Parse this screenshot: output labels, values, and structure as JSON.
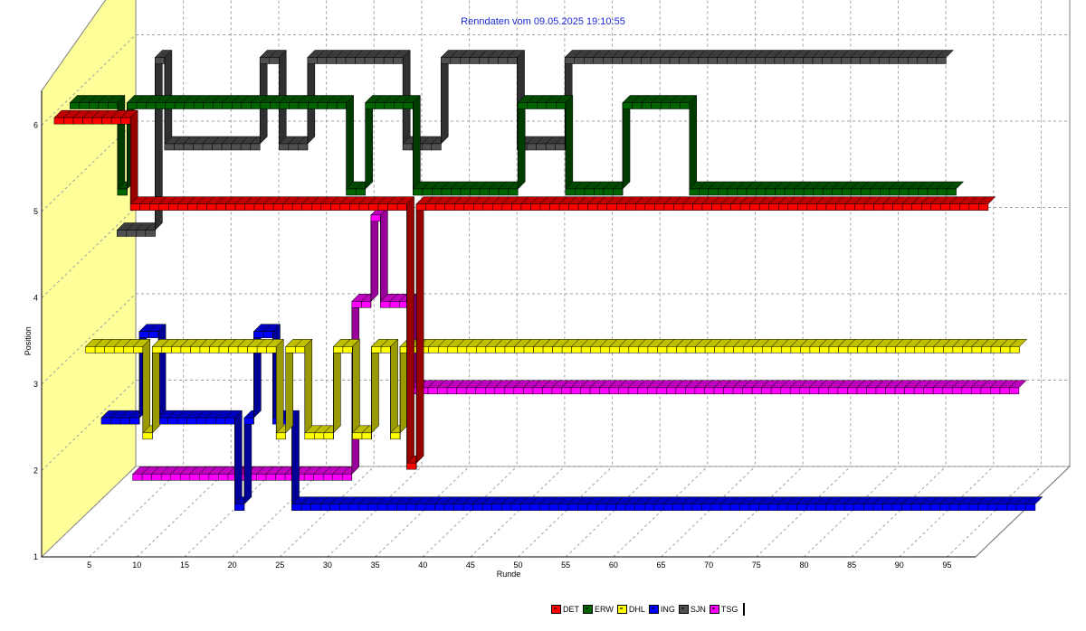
{
  "chart_data": {
    "type": "line",
    "title": "Renndaten vom 09.05.2025 19:10:55",
    "xlabel": "Runde",
    "ylabel": "Position",
    "xlim": [
      0,
      98
    ],
    "ylim": [
      1,
      6
    ],
    "x_ticks": [
      "5",
      "10",
      "15",
      "20",
      "25",
      "30",
      "35",
      "40",
      "45",
      "50",
      "55",
      "60",
      "65",
      "70",
      "75",
      "80",
      "85",
      "90",
      "95"
    ],
    "y_ticks": [
      "1",
      "2",
      "3",
      "4",
      "5",
      "6"
    ],
    "grid": true,
    "legend_position": "bottom",
    "series": [
      {
        "name": "DET",
        "color": "#ff0000",
        "x_start": 1,
        "x_end": 98,
        "segments": [
          [
            1,
            4,
            6
          ],
          [
            5,
            8,
            6
          ],
          [
            9,
            37,
            5
          ],
          [
            38,
            38,
            2
          ],
          [
            39,
            98,
            5
          ]
        ]
      },
      {
        "name": "ERW",
        "color": "#006400",
        "x_start": 1,
        "x_end": 93,
        "segments": [
          [
            1,
            5,
            6
          ],
          [
            6,
            6,
            5
          ],
          [
            7,
            29,
            6
          ],
          [
            30,
            31,
            5
          ],
          [
            32,
            36,
            6
          ],
          [
            37,
            47,
            5
          ],
          [
            48,
            52,
            6
          ],
          [
            53,
            58,
            5
          ],
          [
            59,
            65,
            6
          ],
          [
            66,
            93,
            5
          ]
        ]
      },
      {
        "name": "DHL",
        "color": "#ffff00",
        "x_start": 1,
        "x_end": 98,
        "segments": [
          [
            1,
            6,
            3
          ],
          [
            7,
            7,
            2
          ],
          [
            8,
            20,
            3
          ],
          [
            21,
            21,
            2
          ],
          [
            22,
            23,
            3
          ],
          [
            24,
            26,
            2
          ],
          [
            27,
            28,
            3
          ],
          [
            29,
            30,
            2
          ],
          [
            31,
            32,
            3
          ],
          [
            33,
            33,
            2
          ],
          [
            34,
            98,
            3
          ]
        ]
      },
      {
        "name": "ING",
        "color": "#0000ff",
        "x_start": 1,
        "x_end": 98,
        "segments": [
          [
            1,
            4,
            2
          ],
          [
            5,
            6,
            3
          ],
          [
            7,
            14,
            2
          ],
          [
            15,
            15,
            1
          ],
          [
            16,
            16,
            2
          ],
          [
            17,
            18,
            3
          ],
          [
            19,
            20,
            2
          ],
          [
            21,
            98,
            1
          ]
        ]
      },
      {
        "name": "SJN",
        "color": "#505050",
        "x_start": 1,
        "x_end": 87,
        "segments": [
          [
            1,
            4,
            4
          ],
          [
            5,
            5,
            6
          ],
          [
            6,
            6,
            5
          ],
          [
            7,
            15,
            5
          ],
          [
            16,
            17,
            6
          ],
          [
            18,
            20,
            5
          ],
          [
            21,
            30,
            6
          ],
          [
            31,
            34,
            5
          ],
          [
            35,
            42,
            6
          ],
          [
            43,
            47,
            5
          ],
          [
            48,
            51,
            6
          ],
          [
            52,
            87,
            6
          ]
        ]
      },
      {
        "name": "TSG",
        "color": "#ff00ff",
        "x_start": 1,
        "x_end": 93,
        "segments": [
          [
            1,
            23,
            1
          ],
          [
            24,
            25,
            3
          ],
          [
            26,
            26,
            4
          ],
          [
            27,
            27,
            3
          ],
          [
            28,
            29,
            3
          ],
          [
            30,
            93,
            2
          ]
        ]
      }
    ]
  }
}
